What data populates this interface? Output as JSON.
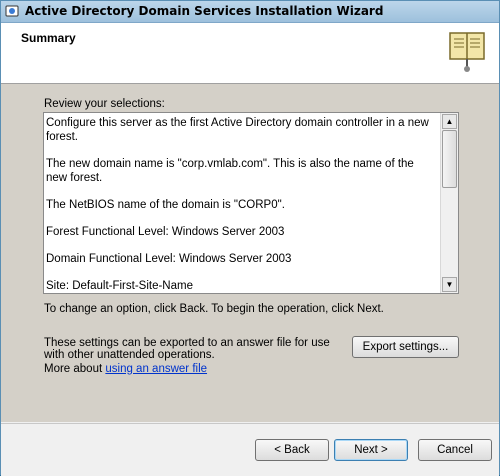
{
  "window": {
    "title": "Active Directory Domain Services Installation Wizard",
    "page_title": "Summary"
  },
  "review": {
    "label": "Review your selections:",
    "lines": [
      "Configure this server as the first Active Directory domain controller in a new forest.",
      "The new domain name is \"corp.vmlab.com\". This is also the name of the new forest.",
      "The NetBIOS name of the domain is \"CORP0\".",
      "Forest Functional Level: Windows Server 2003",
      "Domain Functional Level: Windows Server 2003",
      "Site: Default-First-Site-Name"
    ]
  },
  "instructions": {
    "change_option": "To change an option, click Back. To begin the operation, click Next.",
    "export_text": "These settings can be exported to an answer file for use with other unattended operations.",
    "more_about_prefix": "More about ",
    "more_about_link": "using an answer file"
  },
  "buttons": {
    "export": "Export settings...",
    "back": "< Back",
    "next": "Next >",
    "cancel": "Cancel"
  },
  "icons": {
    "app": "ad-wizard-icon",
    "header": "open-book-icon"
  }
}
